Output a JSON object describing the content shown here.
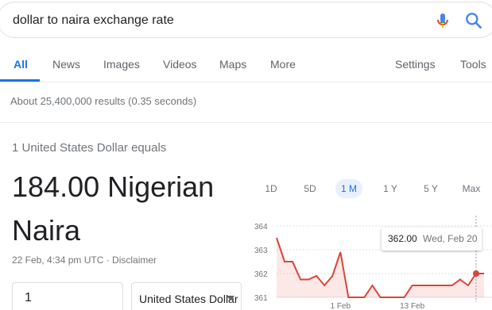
{
  "search": {
    "query": "dollar to naira exchange rate"
  },
  "tabs": [
    {
      "label": "All"
    },
    {
      "label": "News"
    },
    {
      "label": "Images"
    },
    {
      "label": "Videos"
    },
    {
      "label": "Maps"
    },
    {
      "label": "More"
    },
    {
      "label": "Settings"
    },
    {
      "label": "Tools"
    }
  ],
  "results_stats": "About 25,400,000 results (0.35 seconds)",
  "converter": {
    "equals_label": "1 United States Dollar equals",
    "rate_line1": "184.00 Nigerian",
    "rate_line2": "Naira",
    "timestamp": "22 Feb, 4:34 pm UTC · Disclaimer",
    "amount": "1",
    "currency": "United States Dollar"
  },
  "ranges": [
    {
      "label": "1D"
    },
    {
      "label": "5D"
    },
    {
      "label": "1 M"
    },
    {
      "label": "1 Y"
    },
    {
      "label": "5 Y"
    },
    {
      "label": "Max"
    }
  ],
  "tooltip": {
    "value": "362.00",
    "date": "Wed, Feb 20"
  },
  "colors": {
    "accent": "#1a73e8",
    "line": "#db4437"
  },
  "chart_data": {
    "type": "area",
    "y_ticks": [
      "364",
      "363",
      "362",
      "361"
    ],
    "x_ticks": [
      "1 Feb",
      "13 Feb"
    ],
    "ylim": [
      361,
      364
    ],
    "values": [
      363.5,
      362.5,
      362.5,
      361.75,
      361.75,
      361.9,
      361.5,
      361.9,
      362.9,
      361.0,
      361.0,
      361.0,
      361.5,
      361.0,
      361.0,
      361.0,
      361.0,
      361.5,
      361.5,
      361.5,
      361.5,
      361.5,
      361.5,
      361.75,
      361.5,
      362.0,
      362.0
    ],
    "highlight": {
      "value": 362.0,
      "label": "Wed, Feb 20"
    }
  }
}
